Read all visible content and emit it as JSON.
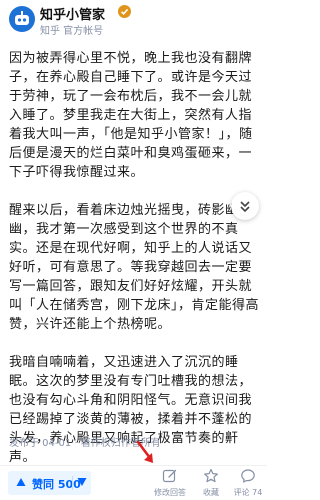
{
  "author": {
    "name": "知乎小管家",
    "description": "知乎 官方帐号"
  },
  "content": {
    "paragraphs": [
      "因为被弄得心里不悦，晚上我也没有翻牌子，在养心殿自己睡下了。或许是今天过于劳神，玩了一会布枕后，我不一会儿就入睡了。梦里我走在大街上，突然有人指着我大叫一声，「他是知乎小管家！」，随后便是漫天的烂白菜叶和臭鸡蛋砸来，一下子吓得我惊醒过来。",
      "醒来以后，看着床边烛光摇曳，砖影幽幽，我才第一次感受到这个世界的不真实。还是在现代好啊，知乎上的人说话又好听，可有意思了。等我穿越回去一定要写一篇回答，跟知友们好好炫耀，开头就叫「人在储秀宫，刚下龙床」，肯定能得高赞，兴许还能上个热榜呢。",
      "我暗自喃喃着，又迅速进入了沉沉的睡眠。这次的梦里没有专门吐槽我的想法，也没有勾心斗角和阴阳怪气。无意识间我已经踢掉了淡黄的薄被，揉着并不蓬松的头发，养心殿里又响起了极富节奏的鼾声。"
    ],
    "footer": "发布于 04-01 · 著作权归作者所有"
  },
  "bottom_bar": {
    "vote_label": "赞同 500",
    "edit_label": "修改回答",
    "favorite_label": "收藏",
    "comment_label": "评论 74"
  },
  "colors": {
    "accent": "#0066ff",
    "vote_bg": "#ebf5ff",
    "meta_text": "#8590a6",
    "annotation_arrow": "#e02020",
    "verified_badge": "#e09419"
  },
  "icons": {
    "avatar": "zhihu-assistant-avatar",
    "verified": "verified-badge-icon",
    "expand": "chevron-down-icon",
    "vote_up": "triangle-up-icon",
    "vote_down": "triangle-down-icon",
    "edit": "edit-pencil-icon",
    "favorite": "star-icon",
    "comment": "comment-bubble-icon"
  }
}
